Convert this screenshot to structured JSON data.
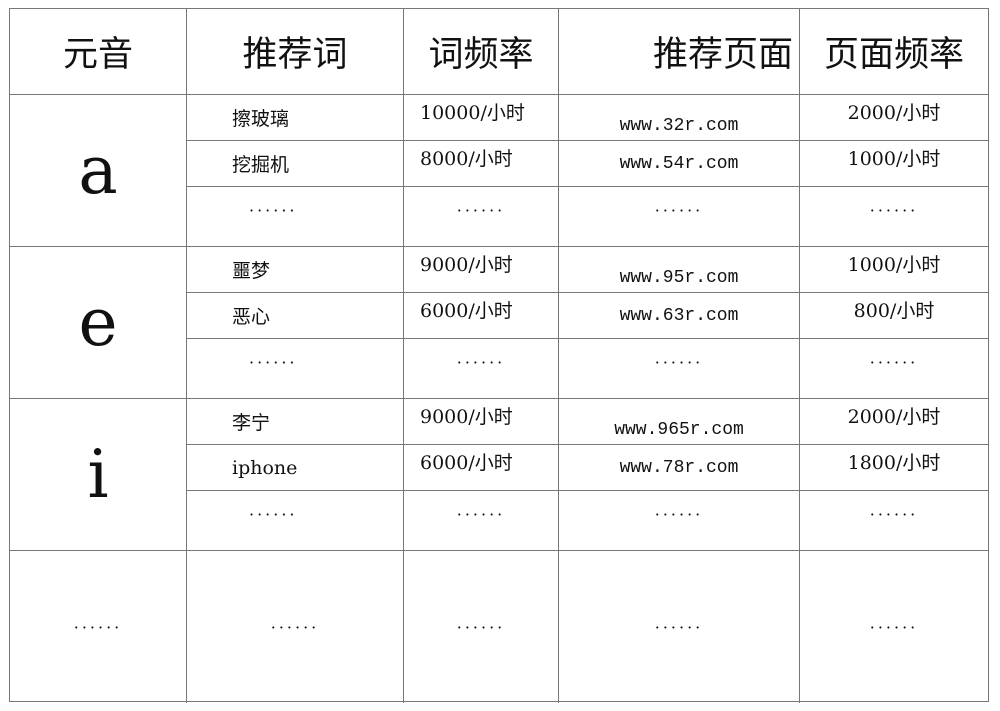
{
  "table": {
    "headers": [
      "元音",
      "推荐词",
      "词频率",
      "推荐页面",
      "页面频率"
    ],
    "groups": [
      {
        "vowel": "a",
        "rows": [
          {
            "word": "擦玻璃",
            "word_freq": "10000/小时",
            "page": "www.32r.com",
            "page_freq": "2000/小时"
          },
          {
            "word": "挖掘机",
            "word_freq": "8000/小时",
            "page": "www.54r.com",
            "page_freq": "1000/小时"
          },
          {
            "word": "······",
            "word_freq": "······",
            "page": "······",
            "page_freq": "······"
          }
        ]
      },
      {
        "vowel": "e",
        "rows": [
          {
            "word": "噩梦",
            "word_freq": "9000/小时",
            "page": "www.95r.com",
            "page_freq": "1000/小时"
          },
          {
            "word": "恶心",
            "word_freq": "6000/小时",
            "page": "www.63r.com",
            "page_freq": "800/小时"
          },
          {
            "word": "······",
            "word_freq": "······",
            "page": "······",
            "page_freq": "······"
          }
        ]
      },
      {
        "vowel": "i",
        "rows": [
          {
            "word": "李宁",
            "word_freq": "9000/小时",
            "page": "www.965r.com",
            "page_freq": "2000/小时"
          },
          {
            "word": "iphone",
            "word_freq": "6000/小时",
            "page": "www.78r.com",
            "page_freq": "1800/小时"
          },
          {
            "word": "······",
            "word_freq": "······",
            "page": "······",
            "page_freq": "······"
          }
        ]
      }
    ],
    "last_row": [
      "······",
      "······",
      "······",
      "······",
      "······"
    ]
  }
}
